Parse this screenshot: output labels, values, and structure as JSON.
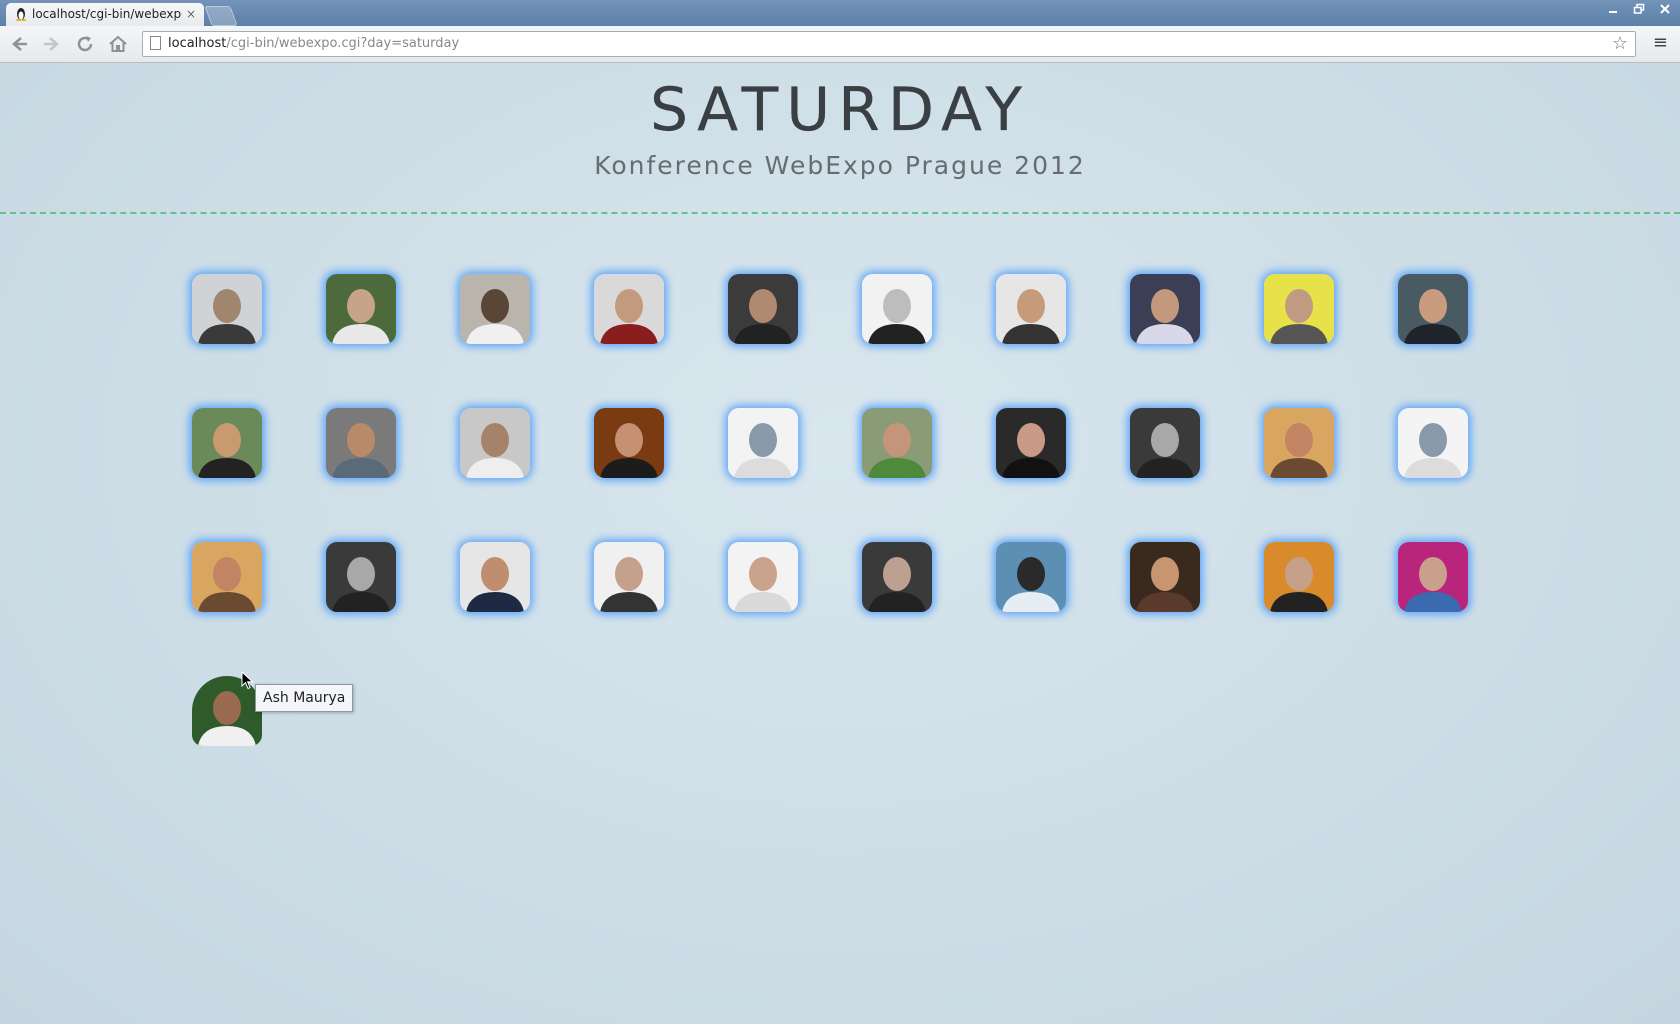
{
  "browser": {
    "tab_title": "localhost/cgi-bin/webexpo",
    "tab_close": "×",
    "url_host": "localhost",
    "url_path": "/cgi-bin/webexpo.cgi?day=saturday"
  },
  "page": {
    "title": "SATURDAY",
    "subtitle": "Konference WebExpo Prague 2012"
  },
  "tooltip": "Ash Maurya",
  "speakers_row_count": 4,
  "speakers_per_row": [
    10,
    10,
    10,
    1
  ]
}
